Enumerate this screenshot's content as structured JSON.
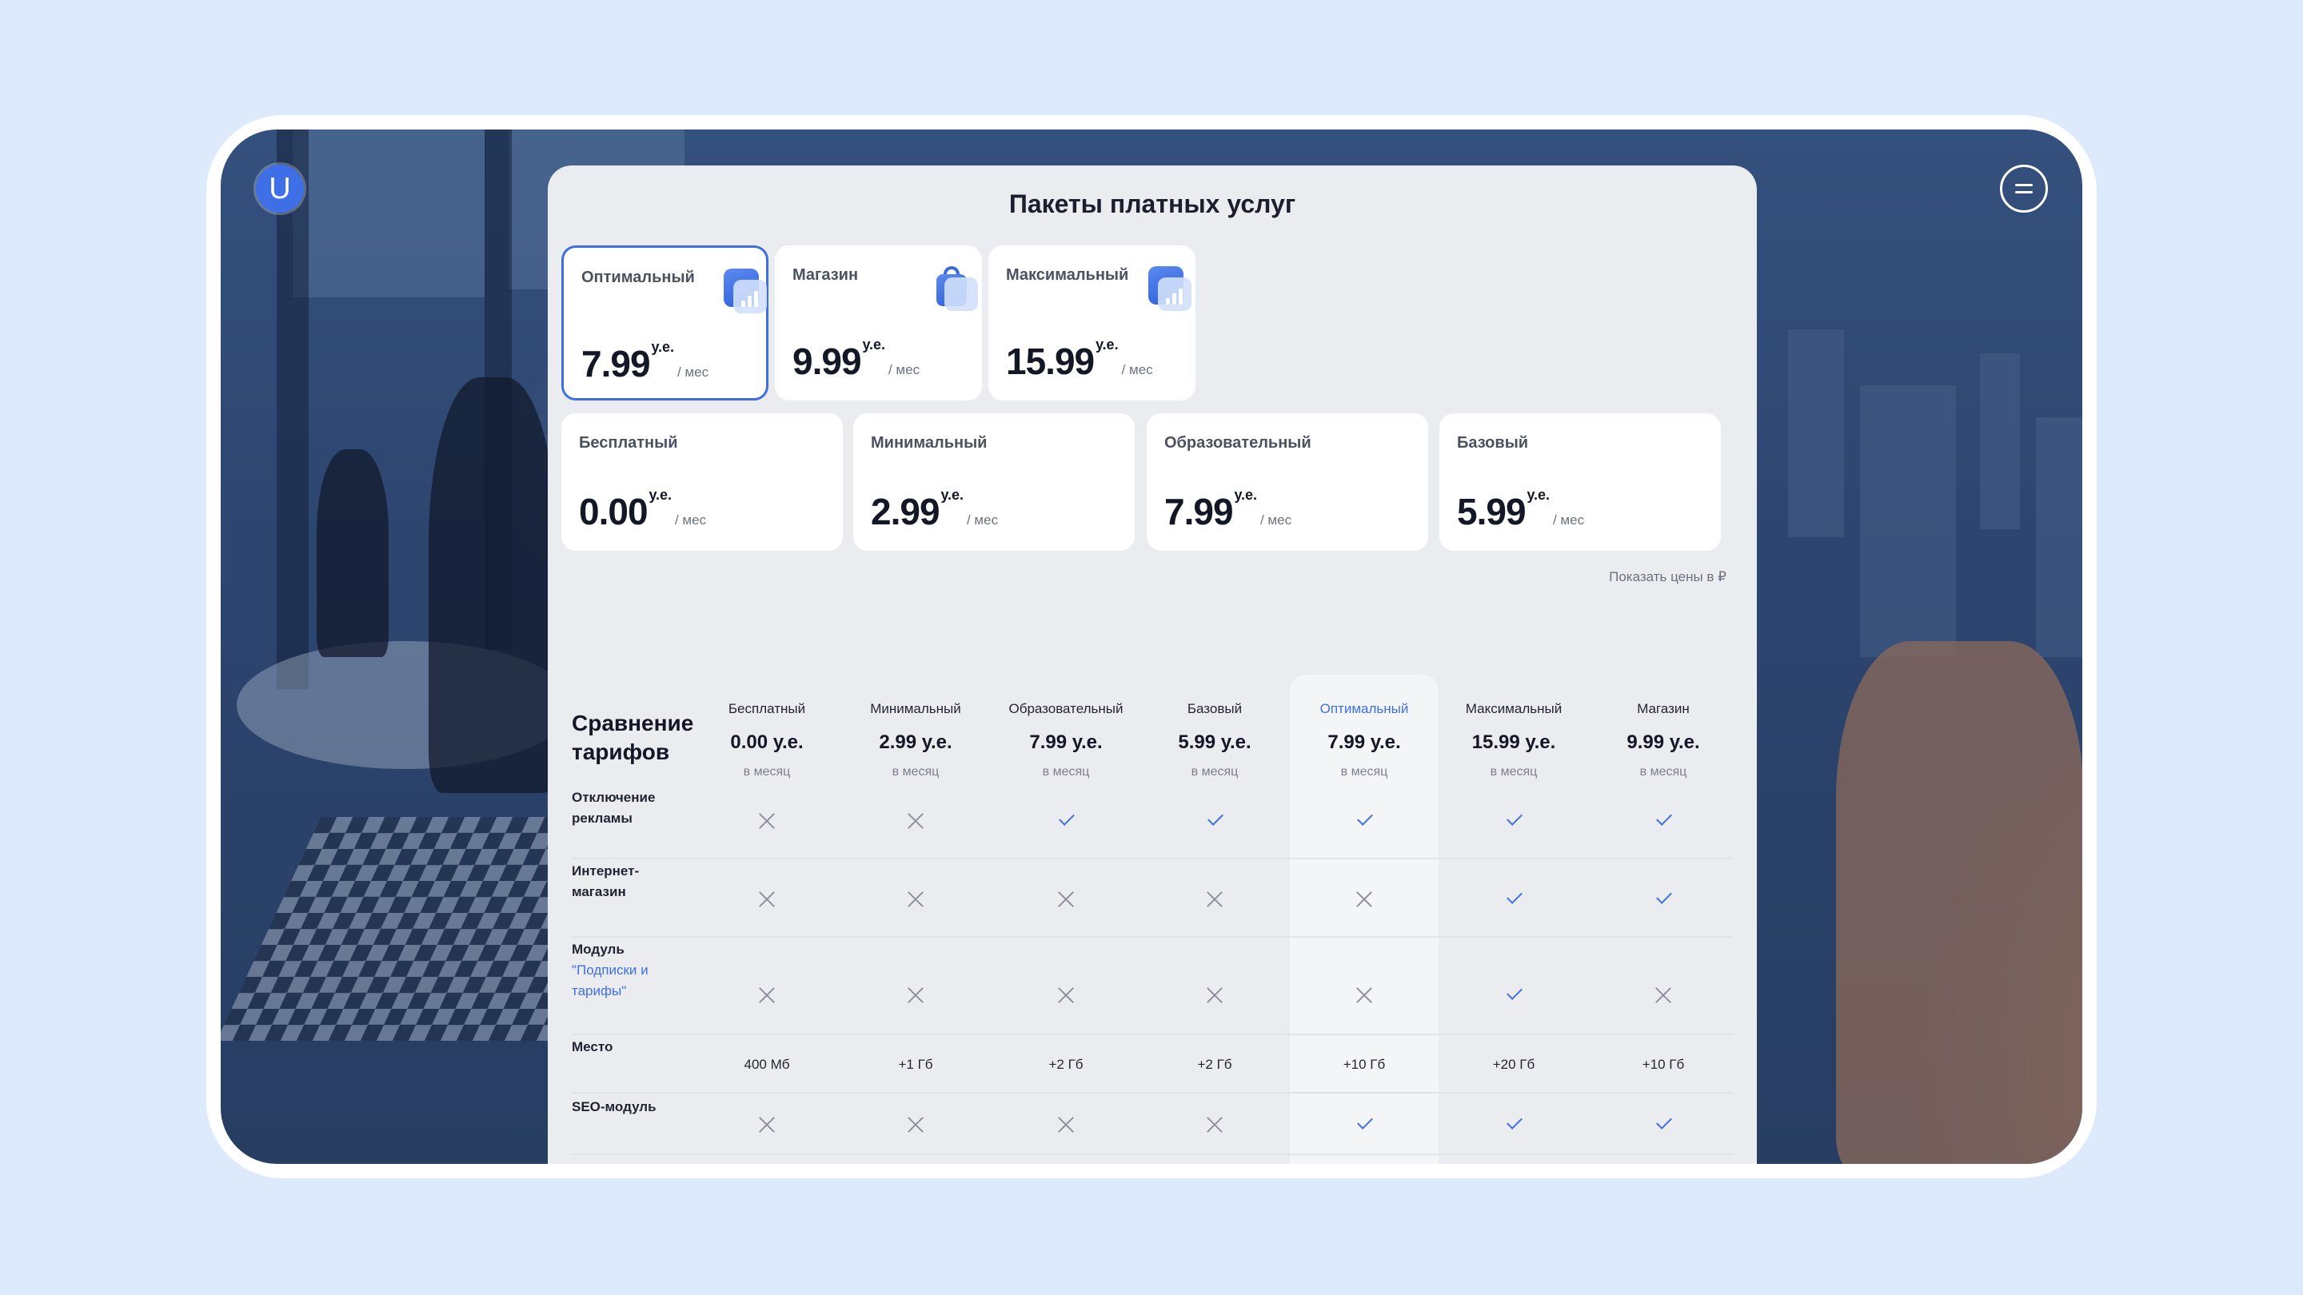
{
  "brand": {
    "logo_letter": "U"
  },
  "panel": {
    "title": "Пакеты платных услуг"
  },
  "accent_color": "#3f6fe6",
  "featured_plans": [
    {
      "name": "Оптимальный",
      "price": "7.99",
      "currency": "у.е.",
      "period": "/ мес",
      "icon": "chart-icon",
      "selected": true
    },
    {
      "name": "Магазин",
      "price": "9.99",
      "currency": "у.е.",
      "period": "/ мес",
      "icon": "shopping-bag-icon",
      "selected": false
    },
    {
      "name": "Максимальный",
      "price": "15.99",
      "currency": "у.е.",
      "period": "/ мес",
      "icon": "chart-icon",
      "selected": false
    }
  ],
  "plans": [
    {
      "name": "Бесплатный",
      "price": "0.00",
      "currency": "у.е.",
      "period": "/ мес"
    },
    {
      "name": "Минимальный",
      "price": "2.99",
      "currency": "у.е.",
      "period": "/ мес"
    },
    {
      "name": "Образовательный",
      "price": "7.99",
      "currency": "у.е.",
      "period": "/ мес"
    },
    {
      "name": "Базовый",
      "price": "5.99",
      "currency": "у.е.",
      "period": "/ мес"
    }
  ],
  "show_rub_link": "Показать цены в ₽",
  "comparison": {
    "title_line1": "Сравнение",
    "title_line2": "тарифов",
    "columns": [
      {
        "name": "Бесплатный",
        "price": "0.00 у.е.",
        "period": "в месяц"
      },
      {
        "name": "Минимальный",
        "price": "2.99 у.е.",
        "period": "в месяц"
      },
      {
        "name": "Образовательный",
        "price": "7.99 у.е.",
        "period": "в месяц"
      },
      {
        "name": "Базовый",
        "price": "5.99 у.е.",
        "period": "в месяц"
      },
      {
        "name": "Оптимальный",
        "price": "7.99 у.е.",
        "period": "в месяц",
        "highlight": true
      },
      {
        "name": "Максимальный",
        "price": "15.99 у.е.",
        "period": "в месяц"
      },
      {
        "name": "Магазин",
        "price": "9.99 у.е.",
        "period": "в месяц"
      }
    ],
    "rows": [
      {
        "label_lines": [
          "Отключение",
          "рекламы"
        ],
        "values": [
          "no",
          "no",
          "yes",
          "yes",
          "yes",
          "yes",
          "yes"
        ]
      },
      {
        "label_lines": [
          "Интернет-",
          "магазин"
        ],
        "values": [
          "no",
          "no",
          "no",
          "no",
          "no",
          "yes",
          "yes"
        ]
      },
      {
        "label_lines": [
          "Модуль"
        ],
        "label_link_lines": [
          "\"Подписки и",
          "тарифы\""
        ],
        "values": [
          "no",
          "no",
          "no",
          "no",
          "no",
          "yes",
          "no"
        ]
      },
      {
        "label_lines": [
          "Место"
        ],
        "values": [
          "400 Мб",
          "+1 Гб",
          "+2 Гб",
          "+2 Гб",
          "+10 Гб",
          "+20 Гб",
          "+10 Гб"
        ]
      },
      {
        "label_lines": [
          "SEO-модуль"
        ],
        "values": [
          "no",
          "no",
          "no",
          "no",
          "yes",
          "yes",
          "yes"
        ]
      }
    ]
  }
}
